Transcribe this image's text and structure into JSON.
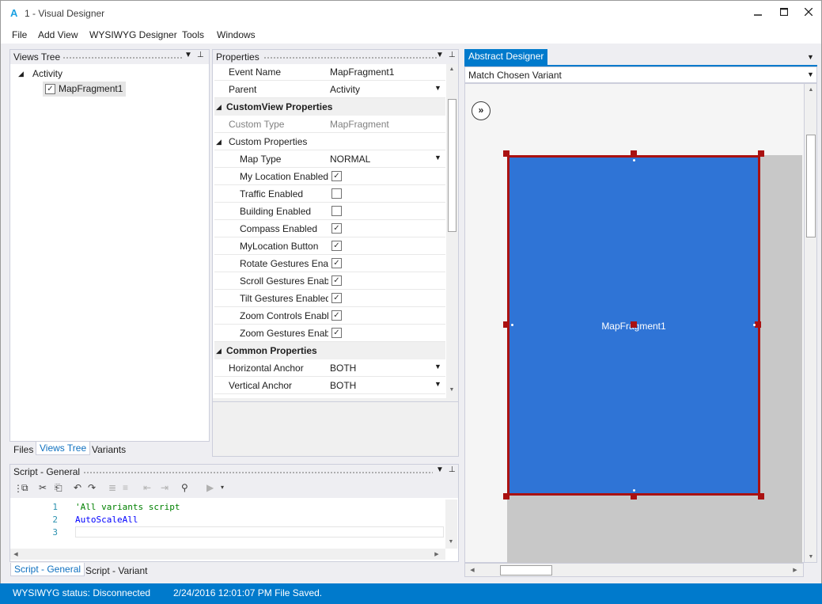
{
  "window": {
    "app_icon": "A",
    "title": "1 - Visual Designer",
    "minimize": "‗",
    "maximize": "□",
    "close": "✕"
  },
  "menu": [
    "File",
    "Add View",
    "WYSIWYG Designer",
    "Tools",
    "Windows"
  ],
  "views_tree": {
    "title": "Views Tree",
    "root": "Activity",
    "child": "MapFragment1",
    "child_checked": true,
    "tabs": [
      "Files",
      "Views Tree",
      "Variants"
    ],
    "active_tab": "Views Tree"
  },
  "properties": {
    "title": "Properties",
    "rows": [
      {
        "kind": "prop",
        "name": "Event Name",
        "value": "MapFragment1",
        "indent": 0
      },
      {
        "kind": "prop",
        "name": "Parent",
        "value": "Activity",
        "dropdown": true,
        "indent": 0
      },
      {
        "kind": "cat",
        "name": "CustomView Properties"
      },
      {
        "kind": "prop",
        "name": "Custom Type",
        "value": "MapFragment",
        "grey": true,
        "indent": 0
      },
      {
        "kind": "sub",
        "name": "Custom Properties"
      },
      {
        "kind": "prop",
        "name": "Map Type",
        "value": "NORMAL",
        "dropdown": true,
        "indent": 1
      },
      {
        "kind": "check",
        "name": "My Location Enabled",
        "checked": true
      },
      {
        "kind": "check",
        "name": "Traffic Enabled",
        "checked": false
      },
      {
        "kind": "check",
        "name": "Building Enabled",
        "checked": false
      },
      {
        "kind": "check",
        "name": "Compass Enabled",
        "checked": true
      },
      {
        "kind": "check",
        "name": "MyLocation Button",
        "checked": true
      },
      {
        "kind": "check",
        "name": "Rotate Gestures Enabled",
        "checked": true
      },
      {
        "kind": "check",
        "name": "Scroll Gestures Enabled",
        "checked": true
      },
      {
        "kind": "check",
        "name": "Tilt Gestures Enabled",
        "checked": true
      },
      {
        "kind": "check",
        "name": "Zoom Controls Enabled",
        "checked": true
      },
      {
        "kind": "check",
        "name": "Zoom Gestures Enabled",
        "checked": true
      },
      {
        "kind": "cat",
        "name": "Common Properties"
      },
      {
        "kind": "prop",
        "name": "Horizontal Anchor",
        "value": "BOTH",
        "dropdown": true,
        "indent": 0
      },
      {
        "kind": "prop",
        "name": "Vertical Anchor",
        "value": "BOTH",
        "dropdown": true,
        "indent": 0
      }
    ]
  },
  "script": {
    "title": "Script - General",
    "lines": [
      {
        "no": "1",
        "text": "'All variants script",
        "color": "#008000"
      },
      {
        "no": "2",
        "text": "AutoScaleAll",
        "color": "#0000ff"
      },
      {
        "no": "3",
        "text": "",
        "color": "#000000"
      }
    ],
    "tabs": [
      "Script - General",
      "Script - Variant"
    ],
    "active_tab": "Script - General"
  },
  "designer": {
    "tab": "Abstract Designer",
    "variant_combo": "Match Chosen Variant",
    "view_label": "MapFragment1",
    "view_color": "#2f74d6",
    "selection_color": "#aa1111"
  },
  "status": {
    "left": "WYSIWYG status: Disconnected",
    "right": "2/24/2016 12:01:07 PM  File Saved."
  }
}
